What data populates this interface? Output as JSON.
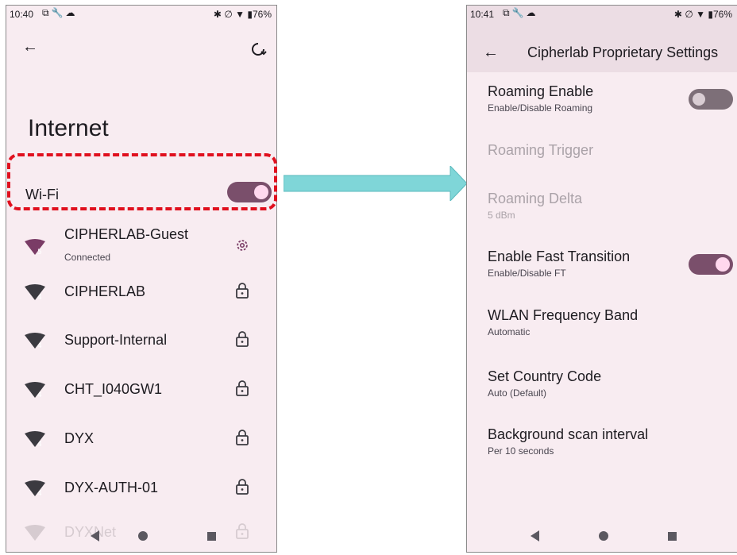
{
  "left_phone": {
    "status": {
      "time": "10:40",
      "battery": "76%"
    },
    "title": "Internet",
    "wifi_label": "Wi-Fi",
    "wifi_on": true,
    "networks": [
      {
        "name": "CIPHERLAB-Guest",
        "sub": "Connected",
        "badge": "5",
        "action_icon": "gear-icon",
        "color": "#7a3c66"
      },
      {
        "name": "CIPHERLAB",
        "sub": "",
        "badge": "4",
        "action_icon": "lock-icon",
        "color": "#3b3a40"
      },
      {
        "name": "Support-Internal",
        "sub": "",
        "badge": "4",
        "action_icon": "lock-icon",
        "color": "#3b3a40"
      },
      {
        "name": "CHT_I040GW1",
        "sub": "",
        "badge": "4",
        "action_icon": "lock-icon",
        "color": "#3b3a40"
      },
      {
        "name": "DYX",
        "sub": "",
        "badge": "4",
        "action_icon": "lock-icon",
        "color": "#3b3a40"
      },
      {
        "name": "DYX-AUTH-01",
        "sub": "",
        "badge": "4",
        "action_icon": "lock-icon",
        "color": "#3b3a40"
      },
      {
        "name": "DYXNet",
        "sub": "",
        "badge": "",
        "action_icon": "lock-icon",
        "color": "#d6cbd0"
      }
    ]
  },
  "right_phone": {
    "status": {
      "time": "10:41",
      "battery": "76%"
    },
    "header_title": "Cipherlab Proprietary Settings",
    "settings": [
      {
        "title": "Roaming Enable",
        "subtitle": "Enable/Disable Roaming",
        "toggle": "off",
        "enabled": true
      },
      {
        "title": "Roaming Trigger",
        "subtitle": "",
        "toggle": "",
        "enabled": false
      },
      {
        "title": "Roaming Delta",
        "subtitle": "5 dBm",
        "toggle": "",
        "enabled": false
      },
      {
        "title": "Enable Fast Transition",
        "subtitle": "Enable/Disable FT",
        "toggle": "on",
        "enabled": true
      },
      {
        "title": "WLAN Frequency Band",
        "subtitle": "Automatic",
        "toggle": "",
        "enabled": true
      },
      {
        "title": "Set Country Code",
        "subtitle": "Auto (Default)",
        "toggle": "",
        "enabled": true
      },
      {
        "title": "Background scan interval",
        "subtitle": "Per 10 seconds",
        "toggle": "",
        "enabled": true
      }
    ]
  },
  "colors": {
    "highlight": "#e0101e",
    "arrow": "#7fd6d8",
    "accent": "#7a4f6b",
    "background": "#f8ecf1"
  }
}
